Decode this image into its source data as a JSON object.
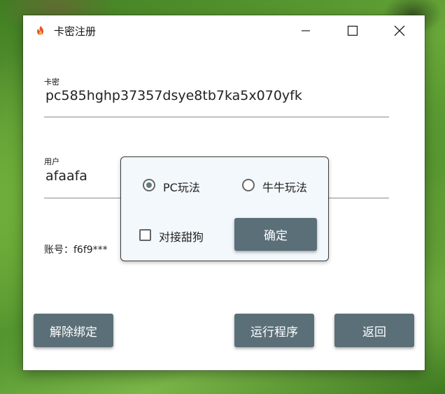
{
  "window": {
    "title": "卡密注册"
  },
  "form": {
    "card_label": "卡密",
    "card_value": "pc585hghp37357dsye8tb7ka5x070yfk",
    "user_label": "用户",
    "user_value": "afaafa",
    "account_text": "账号：f6f9***"
  },
  "popup": {
    "option_pc": "PC玩法",
    "option_niuniu": "牛牛玩法",
    "selected": "PC玩法",
    "checkbox_label": "对接甜狗",
    "checkbox_checked": false,
    "confirm_label": "确定"
  },
  "buttons": {
    "unbind": "解除绑定",
    "run": "运行程序",
    "back": "返回"
  },
  "colors": {
    "button_bg": "#5b6f78",
    "popup_bg": "#f3f8fc"
  }
}
